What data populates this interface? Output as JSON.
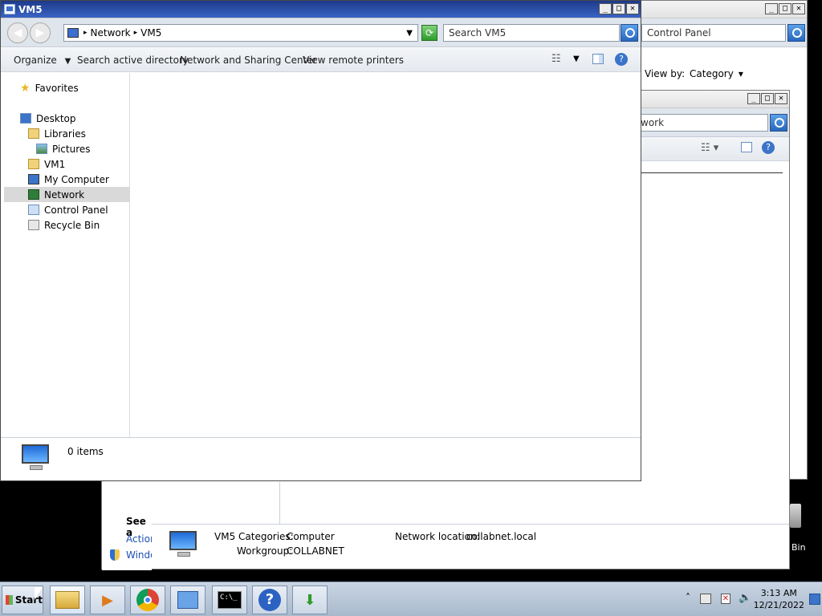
{
  "background_window_1": {
    "search_value": "Control Panel",
    "view_by_label": "View by:",
    "view_by_value": "Category",
    "window_controls": [
      "_",
      "□",
      "✕"
    ]
  },
  "background_window_2": {
    "search_value": "work",
    "see_also_label": "See a",
    "action_label": "Action",
    "windows_label": "Windo",
    "details": {
      "name": "VM5",
      "categories_label": "Categories:",
      "categories_value": "Computer",
      "workgroup_label": "Workgroup:",
      "workgroup_value": "COLLABNET",
      "network_location_label": "Network location:",
      "network_location_value": "collabnet.local"
    },
    "desktop_bin_label": "Bin"
  },
  "main_window": {
    "title": "VM5",
    "breadcrumb": [
      "Network",
      "VM5"
    ],
    "search_placeholder": "Search VM5",
    "commands": {
      "organize": "Organize",
      "search_ad": "Search active directory",
      "network_sharing": "Network and Sharing Center",
      "view_printers": "View remote printers"
    },
    "nav": {
      "favorites": "Favorites",
      "desktop": "Desktop",
      "libraries": "Libraries",
      "pictures": "Pictures",
      "vm1": "VM1",
      "my_computer": "My Computer",
      "network": "Network",
      "control_panel": "Control Panel",
      "recycle_bin": "Recycle Bin"
    },
    "status": "0 items"
  },
  "taskbar": {
    "start_label": "Start",
    "time": "3:13 AM",
    "date": "12/21/2022",
    "tray_chevron": "˄"
  },
  "colors": {
    "titlebar_active": "#2a4fa8",
    "address_bar": "#dfe5ec",
    "selected_nav": "#d9d9d9",
    "taskbar": "#b9c7d8"
  }
}
